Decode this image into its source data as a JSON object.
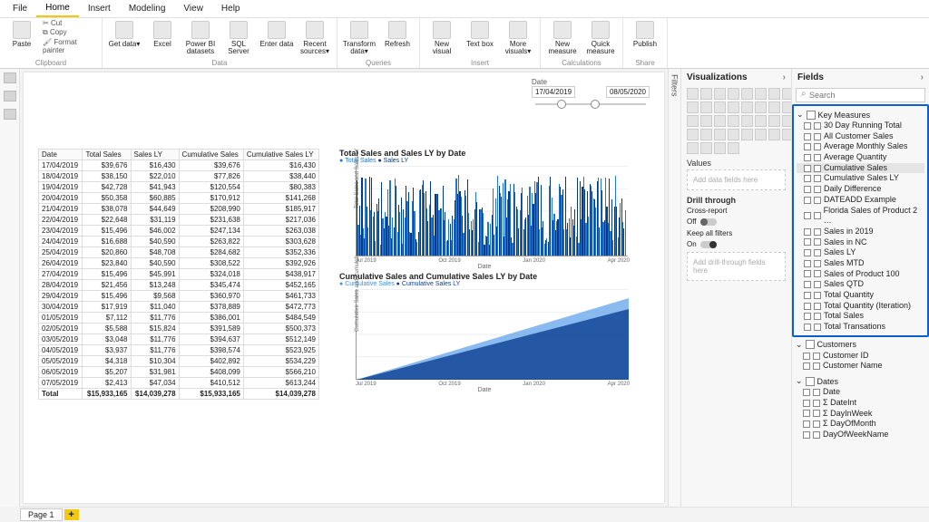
{
  "menu": [
    "File",
    "Home",
    "Insert",
    "Modeling",
    "View",
    "Help"
  ],
  "menu_active": 1,
  "ribbon": {
    "clipboard": {
      "label": "Clipboard",
      "paste": "Paste",
      "cut": "Cut",
      "copy": "Copy",
      "fmt": "Format painter"
    },
    "data": {
      "label": "Data",
      "btns": [
        {
          "l": "Get data▾"
        },
        {
          "l": "Excel"
        },
        {
          "l": "Power BI datasets"
        },
        {
          "l": "SQL Server"
        },
        {
          "l": "Enter data"
        },
        {
          "l": "Recent sources▾"
        }
      ]
    },
    "queries": {
      "label": "Queries",
      "btns": [
        {
          "l": "Transform data▾"
        },
        {
          "l": "Refresh"
        }
      ]
    },
    "insert": {
      "label": "Insert",
      "btns": [
        {
          "l": "New visual"
        },
        {
          "l": "Text box"
        },
        {
          "l": "More visuals▾"
        }
      ]
    },
    "calc": {
      "label": "Calculations",
      "btns": [
        {
          "l": "New measure"
        },
        {
          "l": "Quick measure"
        }
      ]
    },
    "share": {
      "label": "Share",
      "btns": [
        {
          "l": "Publish"
        }
      ]
    }
  },
  "slicer": {
    "title": "Date",
    "from": "17/04/2019",
    "to": "08/05/2020"
  },
  "chart_data": [
    {
      "type": "bar",
      "title": "Total Sales and Sales LY by Date",
      "series_names": [
        "Total Sales",
        "Sales LY"
      ],
      "xlabel": "Date",
      "ylabel": "Total Sales and Sales LY",
      "ylim": [
        0,
        200000
      ],
      "yticks": [
        "$0.0M",
        "$0.1M",
        "$0.2M"
      ],
      "xticks": [
        "Jul 2019",
        "Oct 2019",
        "Jan 2020",
        "Apr 2020"
      ]
    },
    {
      "type": "area",
      "title": "Cumulative Sales and Cumulative Sales LY by Date",
      "series_names": [
        "Cumulative Sales",
        "Cumulative Sales LY"
      ],
      "xlabel": "Date",
      "ylabel": "Cumulative Sales and Cumulati…",
      "ylim": [
        0,
        20000000
      ],
      "yticks": [
        "$0M",
        "$5M",
        "$10M",
        "$15M",
        "$20M"
      ],
      "xticks": [
        "Jul 2019",
        "Oct 2019",
        "Jan 2020",
        "Apr 2020"
      ],
      "end_values": {
        "Cumulative Sales": 15933165,
        "Cumulative Sales LY": 14039278
      }
    }
  ],
  "table": {
    "headers": [
      "Date",
      "Total Sales",
      "Sales LY",
      "Cumulative Sales",
      "Cumulative Sales LY"
    ],
    "rows": [
      [
        "17/04/2019",
        "$39,676",
        "$16,430",
        "$39,676",
        "$16,430"
      ],
      [
        "18/04/2019",
        "$38,150",
        "$22,010",
        "$77,826",
        "$38,440"
      ],
      [
        "19/04/2019",
        "$42,728",
        "$41,943",
        "$120,554",
        "$80,383"
      ],
      [
        "20/04/2019",
        "$50,358",
        "$60,885",
        "$170,912",
        "$141,268"
      ],
      [
        "21/04/2019",
        "$38,078",
        "$44,649",
        "$208,990",
        "$185,917"
      ],
      [
        "22/04/2019",
        "$22,648",
        "$31,119",
        "$231,638",
        "$217,036"
      ],
      [
        "23/04/2019",
        "$15,496",
        "$46,002",
        "$247,134",
        "$263,038"
      ],
      [
        "24/04/2019",
        "$16,688",
        "$40,590",
        "$263,822",
        "$303,628"
      ],
      [
        "25/04/2019",
        "$20,860",
        "$48,708",
        "$284,682",
        "$352,336"
      ],
      [
        "26/04/2019",
        "$23,840",
        "$40,590",
        "$308,522",
        "$392,926"
      ],
      [
        "27/04/2019",
        "$15,496",
        "$45,991",
        "$324,018",
        "$438,917"
      ],
      [
        "28/04/2019",
        "$21,456",
        "$13,248",
        "$345,474",
        "$452,165"
      ],
      [
        "29/04/2019",
        "$15,496",
        "$9,568",
        "$360,970",
        "$461,733"
      ],
      [
        "30/04/2019",
        "$17,919",
        "$11,040",
        "$378,889",
        "$472,773"
      ],
      [
        "01/05/2019",
        "$7,112",
        "$11,776",
        "$386,001",
        "$484,549"
      ],
      [
        "02/05/2019",
        "$5,588",
        "$15,824",
        "$391,589",
        "$500,373"
      ],
      [
        "03/05/2019",
        "$3,048",
        "$11,776",
        "$394,637",
        "$512,149"
      ],
      [
        "04/05/2019",
        "$3,937",
        "$11,776",
        "$398,574",
        "$523,925"
      ],
      [
        "05/05/2019",
        "$4,318",
        "$10,304",
        "$402,892",
        "$534,229"
      ],
      [
        "06/05/2019",
        "$5,207",
        "$31,981",
        "$408,099",
        "$566,210"
      ],
      [
        "07/05/2019",
        "$2,413",
        "$47,034",
        "$410,512",
        "$613,244"
      ]
    ],
    "total": [
      "Total",
      "$15,933,165",
      "$14,039,278",
      "$15,933,165",
      "$14,039,278"
    ]
  },
  "viz_panel": {
    "title": "Visualizations",
    "values_label": "Values",
    "values_ph": "Add data fields here",
    "drill_label": "Drill through",
    "cross": "Cross-report",
    "cross_state": "Off",
    "keep": "Keep all filters",
    "keep_state": "On",
    "drill_ph": "Add drill-through fields here"
  },
  "fields_panel": {
    "title": "Fields",
    "search_ph": "Search",
    "tables": [
      {
        "name": "Key Measures",
        "open": true,
        "boxed": true,
        "fields": [
          "30 Day Running Total",
          "All Customer Sales",
          "Average Monthly Sales",
          "Average Quantity",
          "Cumulative Sales",
          "Cumulative Sales LY",
          "Daily Difference",
          "DATEADD Example",
          "Florida Sales of Product 2 …",
          "Sales in 2019",
          "Sales in NC",
          "Sales LY",
          "Sales MTD",
          "Sales of Product 100",
          "Sales QTD",
          "Total Quantity",
          "Total Quantity (Iteration)",
          "Total Sales",
          "Total Transations"
        ],
        "hover": 4
      },
      {
        "name": "Customers",
        "open": true,
        "fields": [
          "Customer ID",
          "Customer Name"
        ]
      },
      {
        "name": "Dates",
        "open": true,
        "fields": [
          "Date",
          "DateInt",
          "DayInWeek",
          "DayOfMonth",
          "DayOfWeekName"
        ],
        "sigma": [
          1,
          2,
          3
        ]
      }
    ]
  },
  "filters_tab": "Filters",
  "page": {
    "name": "Page 1",
    "add": "+"
  }
}
